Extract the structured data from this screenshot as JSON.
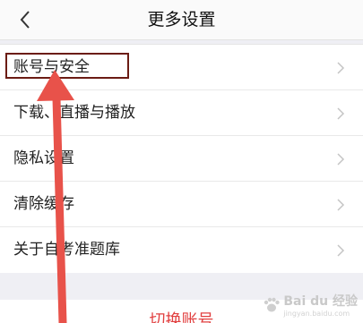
{
  "header": {
    "title": "更多设置",
    "back_icon": "chevron-left-icon"
  },
  "settings": {
    "items": [
      {
        "label": "账号与安全"
      },
      {
        "label": "下载、直播与播放"
      },
      {
        "label": "隐私设置"
      },
      {
        "label": "清除缓存"
      },
      {
        "label": "关于自考准题库"
      }
    ]
  },
  "footer": {
    "switch_account_label": "切换账号"
  },
  "annotation": {
    "highlight_color": "#6b1c14",
    "arrow_color": "#e8524a"
  },
  "watermark": {
    "brand": "Bai du 经验",
    "sub": "jingyan.baidu.com"
  }
}
